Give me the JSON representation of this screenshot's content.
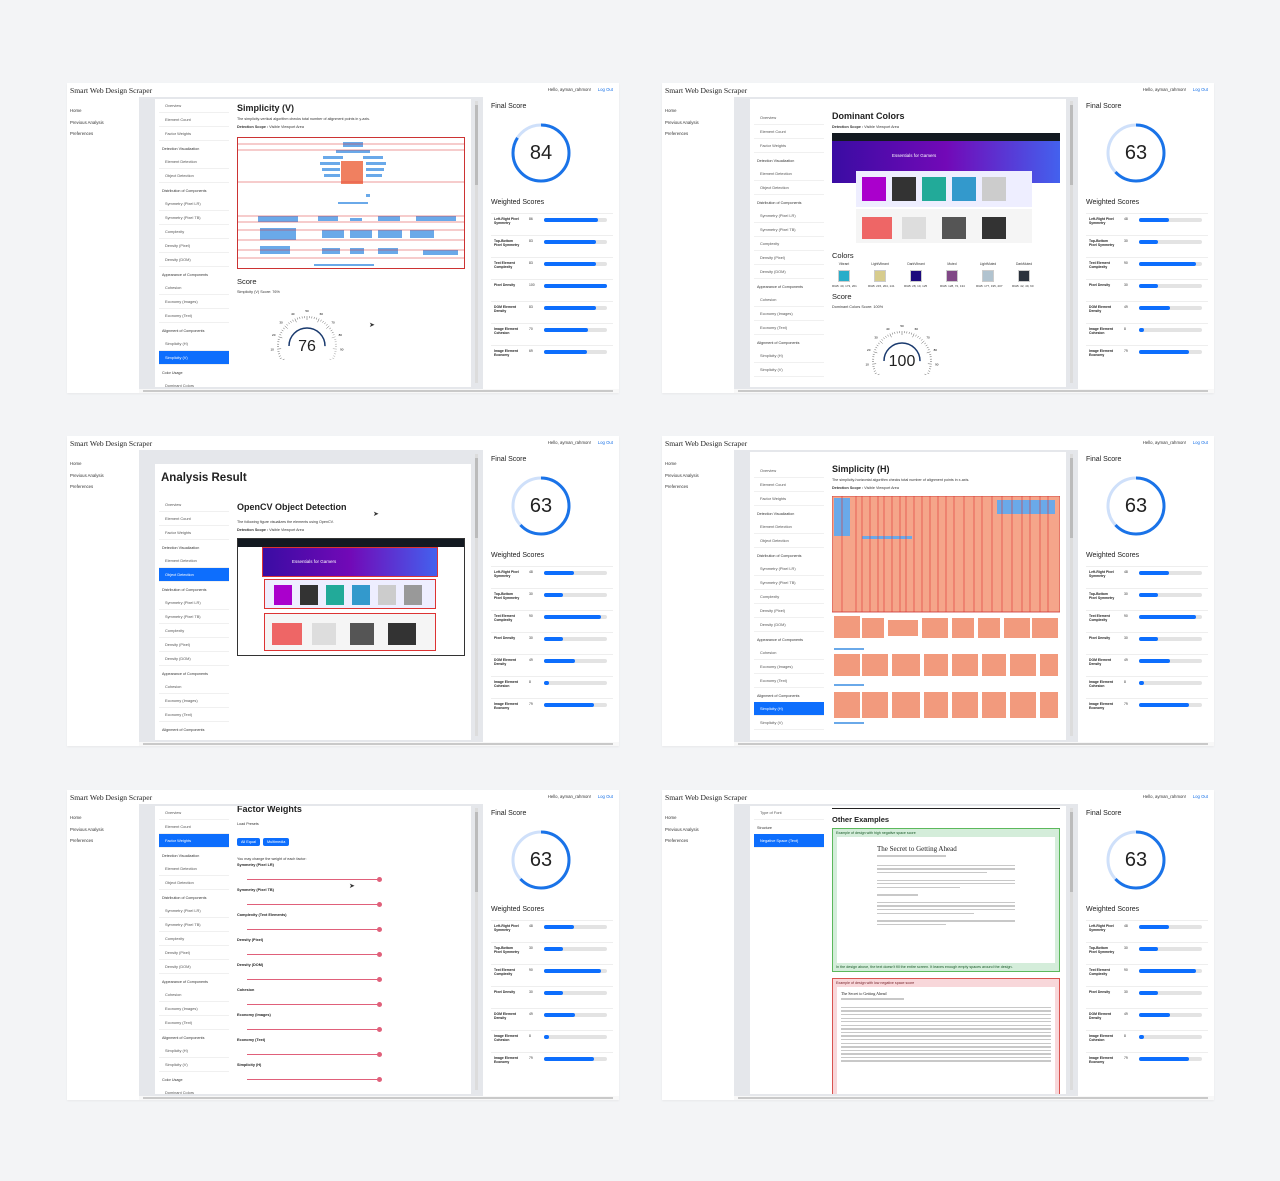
{
  "app": {
    "title": "Smart Web Design Scraper",
    "greeting": "Hello, ayman_rahmon!",
    "logout": "Log Out"
  },
  "nav": [
    "Home",
    "Previous Analysis",
    "Preferences"
  ],
  "menu": {
    "items": [
      "Overview",
      "Element Count",
      "Factor Weights"
    ],
    "groups": [
      {
        "header": "Detection Visualization",
        "items": [
          "Element Detection",
          "Object Detection"
        ]
      },
      {
        "header": "Distribution of Components",
        "items": [
          "Symmetry (Pixel LR)",
          "Symmetry (Pixel TB)",
          "Complexity",
          "Density (Pixel)",
          "Density (DOM)"
        ]
      },
      {
        "header": "Appearance of Components",
        "items": [
          "Cohesion",
          "Economy (Images)",
          "Economy (Text)"
        ]
      },
      {
        "header": "Alignment of Components",
        "items": [
          "Simplicity (H)",
          "Simplicity (V)"
        ]
      },
      {
        "header": "Color Usage",
        "items": [
          "Dominant Colors"
        ]
      }
    ],
    "extra": [
      "Type of Font",
      "Structure",
      "Negative Space (Text)"
    ]
  },
  "labels": {
    "final_score": "Final Score",
    "weighted_scores": "Weighted Scores",
    "score": "Score",
    "detection_scope_label": "Detection Scope :",
    "detection_scope_value": " Visible Viewport Area"
  },
  "screens": [
    {
      "final": 84,
      "weighted": [
        86,
        83,
        83,
        100,
        83,
        70,
        69
      ]
    },
    {
      "final": 63,
      "weighted": [
        48,
        30,
        90,
        30,
        49,
        8,
        79
      ]
    },
    {
      "final": 63,
      "weighted": [
        48,
        30,
        90,
        30,
        49,
        8,
        79
      ]
    },
    {
      "final": 63,
      "weighted": [
        48,
        30,
        90,
        30,
        49,
        8,
        79
      ]
    },
    {
      "final": 63,
      "weighted": [
        48,
        30,
        90,
        30,
        49,
        8,
        79
      ]
    },
    {
      "final": 63,
      "weighted": [
        48,
        30,
        90,
        30,
        49,
        8,
        79
      ]
    }
  ],
  "weighted_labels": [
    "Left-Right Pixel Symmetry",
    "Top-Bottom Pixel Symmetry",
    "Text Element Complexity",
    "Pixel Density",
    "DOM Element Density",
    "Image Element Cohesion",
    "Image Element Economy"
  ],
  "simplicity_v": {
    "title": "Simplicity (V)",
    "desc": "The simplicity-vertical algorithm checks total number of alignment points in y-axis.",
    "score_heading": "Score",
    "score_text": "Simplicity (V) Score: 76%",
    "gauge": 76,
    "gauge_ticks": [
      "0",
      "10",
      "20",
      "30",
      "40",
      "50",
      "60",
      "70",
      "80",
      "90",
      "100"
    ]
  },
  "dominant": {
    "title": "Dominant Colors",
    "colors_heading": "Colors",
    "score_heading": "Score",
    "score_text": "Dominant Colors Score: 100%",
    "gauge": 100,
    "swatches": [
      {
        "name": "Vibrant",
        "hex": "#28adc9",
        "rgb": "RGB: 40, 173, 201"
      },
      {
        "name": "LightVibrant",
        "hex": "#d7cc8d",
        "rgb": "RGB: 215, 204, 141"
      },
      {
        "name": "DarkVibrant",
        "hex": "#1c0a7d",
        "rgb": "RGB: 28, 10, 125"
      },
      {
        "name": "Muted",
        "hex": "#804886",
        "rgb": "RGB: 128, 72, 134"
      },
      {
        "name": "LightMuted",
        "hex": "#b1c3cf",
        "rgb": "RGB: 177, 195, 207"
      },
      {
        "name": "DarkMuted",
        "hex": "#2a313c",
        "rgb": "RGB: 42, 49, 60"
      }
    ]
  },
  "analysis": {
    "heading": "Analysis Result",
    "title": "OpenCV Object Detection",
    "desc": "The following figure visualizes the elements using OpenCV."
  },
  "simplicity_h": {
    "title": "Simplicity (H)",
    "desc": "The simplicity-horizontal algorithm checks total number of alignment points in x-axis."
  },
  "factor": {
    "title": "Factor Weights",
    "load_presets": "Load Presets",
    "preset_buttons": [
      "All Equal",
      "Multimedia"
    ],
    "hint": "You may change the weight of each factor:",
    "sliders": [
      "Symmetry (Pixel LR)",
      "Symmetry (Pixel TB)",
      "Complexity (Text Elements)",
      "Density (Pixel)",
      "Density (DOM)",
      "Cohesion",
      "Economy (Images)",
      "Economy (Text)",
      "Simplicity (H)"
    ]
  },
  "examples": {
    "title": "Other Examples",
    "high_head": "Example of design with high negative space score",
    "high_foot": "In the design above, the text doesn't fill the entire screen. It leaves enough empty spaces around the design.",
    "low_head": "Example of design with low negative space score",
    "article_title": "The Secret to Getting Ahead",
    "article_title_small": "The Secret to Getting Ahead"
  },
  "site_banner": "Essentials for Gamers",
  "colors": {
    "accent": "#0d6efd",
    "ring": "#1a73e8",
    "overlay": "#f08060",
    "box_blue": "#6aa9e9"
  }
}
